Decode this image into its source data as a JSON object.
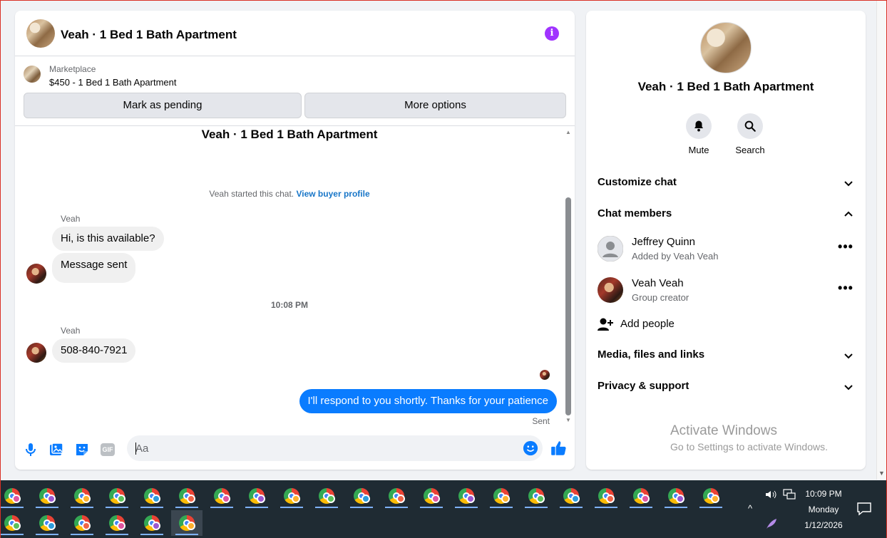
{
  "header": {
    "title": "Veah · 1 Bed 1 Bath Apartment",
    "info_icon": "info-icon",
    "info_glyph": "i"
  },
  "marketplace": {
    "label": "Marketplace",
    "listing": "$450 - 1 Bed 1 Bath Apartment",
    "mark_pending": "Mark as pending",
    "more_options": "More options"
  },
  "conversation": {
    "title": "Veah · 1 Bed 1 Bath Apartment",
    "started_text": "Veah started this chat.",
    "buyer_profile_link": "View buyer profile",
    "group1": {
      "sender": "Veah",
      "messages": [
        "Hi, is this available?",
        "Message sent"
      ]
    },
    "timestamp": "10:08 PM",
    "group2": {
      "sender": "Veah",
      "messages": [
        "508-840-7921"
      ]
    },
    "sent_message": "I'll respond to you shortly. Thanks for your patience",
    "sent_status": "Sent"
  },
  "composer": {
    "placeholder": "Aa",
    "icons": [
      "microphone-icon",
      "photo-icon",
      "sticker-icon",
      "gif-icon",
      "emoji-icon",
      "thumbs-up-icon"
    ],
    "gif_label": "GIF"
  },
  "details": {
    "name": "Veah · 1 Bed 1 Bath Apartment",
    "actions": [
      {
        "label": "Mute",
        "icon": "bell-icon"
      },
      {
        "label": "Search",
        "icon": "search-icon"
      }
    ],
    "sections": {
      "customize": "Customize chat",
      "members": "Chat members",
      "media": "Media, files and links",
      "privacy": "Privacy & support"
    },
    "members": [
      {
        "name": "Jeffrey Quinn",
        "sub": "Added by Veah Veah",
        "more": "•••"
      },
      {
        "name": "Veah Veah",
        "sub": "Group creator",
        "more": "•••"
      }
    ],
    "add_people": "Add people"
  },
  "watermark": {
    "title": "Activate Windows",
    "subtitle": "Go to Settings to activate Windows."
  },
  "taskbar": {
    "app_icon": "chrome-icon",
    "apps_row1": 21,
    "apps_row2": 6,
    "clock_time": "10:09 PM",
    "clock_day": "Monday",
    "clock_date": "1/12/2026",
    "tray_up": "^"
  },
  "colors": {
    "accent_blue": "#0a7cff",
    "link_blue": "#1876c8",
    "info_purple": "#a033ff",
    "taskbar": "#1f2b33"
  }
}
